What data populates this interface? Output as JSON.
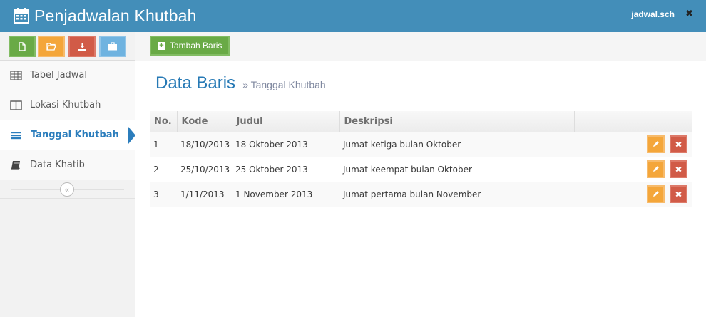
{
  "header": {
    "title": "Penjadwalan Khutbah",
    "user": "jadwal.sch",
    "close_symbol": "✖"
  },
  "shortcuts": [
    {
      "name": "new-file-icon",
      "color": "#69aa46"
    },
    {
      "name": "folder-open-icon",
      "color": "#f4a63a"
    },
    {
      "name": "download-icon",
      "color": "#d15b47"
    },
    {
      "name": "briefcase-icon",
      "color": "#6fb3e0"
    }
  ],
  "sidebar": {
    "items": [
      {
        "label": "Tabel Jadwal",
        "icon": "table-icon",
        "active": false
      },
      {
        "label": "Lokasi Khutbah",
        "icon": "columns-icon",
        "active": false
      },
      {
        "label": "Tanggal Khutbah",
        "icon": "list-icon",
        "active": true
      },
      {
        "label": "Data Khatib",
        "icon": "book-icon",
        "active": false
      }
    ],
    "collapse_symbol": "«"
  },
  "toolbar": {
    "add_label": "Tambah Baris"
  },
  "page": {
    "title": "Data Baris",
    "subtitle": "» Tanggal Khutbah"
  },
  "table": {
    "columns": [
      "No.",
      "Kode",
      "Judul",
      "Deskripsi"
    ],
    "rows": [
      {
        "no": "1",
        "kode": "18/10/2013",
        "judul": "18 Oktober 2013",
        "deskripsi": "Jumat ketiga bulan Oktober"
      },
      {
        "no": "2",
        "kode": "25/10/2013",
        "judul": "25 Oktober 2013",
        "deskripsi": "Jumat keempat bulan Oktober"
      },
      {
        "no": "3",
        "kode": "1/11/2013",
        "judul": "1 November 2013",
        "deskripsi": "Jumat pertama bulan November"
      }
    ]
  },
  "colors": {
    "header_bg": "#438eb9",
    "accent": "#2b7dbc",
    "edit": "#f4a63a",
    "delete": "#d15b47",
    "add": "#69aa46"
  }
}
